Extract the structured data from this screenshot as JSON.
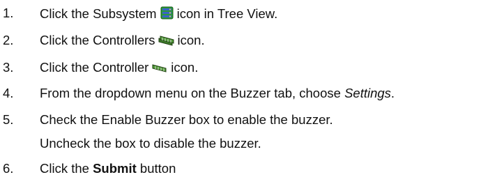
{
  "steps": [
    {
      "number": "1.",
      "before": "Click the Subsystem",
      "icon": "subsystem-icon",
      "after": "icon in Tree View."
    },
    {
      "number": "2.",
      "before": "Click the Controllers",
      "icon": "controllers-icon",
      "after": "icon."
    },
    {
      "number": "3.",
      "before": "Click the Controller",
      "icon": "controller-icon",
      "after": "icon."
    },
    {
      "number": "4.",
      "before": "From the dropdown menu on the Buzzer tab, choose ",
      "italic": "Settings",
      "after": "."
    },
    {
      "number": "5.",
      "line1": "Check the Enable Buzzer box to enable the buzzer.",
      "line2": "Uncheck the box to disable the buzzer."
    },
    {
      "number": "6.",
      "before": "Click the ",
      "bold": "Submit",
      "after": " button"
    }
  ],
  "colors": {
    "subsystem_icon_green": "#2e9a3a",
    "subsystem_icon_blue": "#3a62c8",
    "controller_icon_green": "#3d7a2a",
    "controller_icon_dark": "#1f3f12"
  }
}
